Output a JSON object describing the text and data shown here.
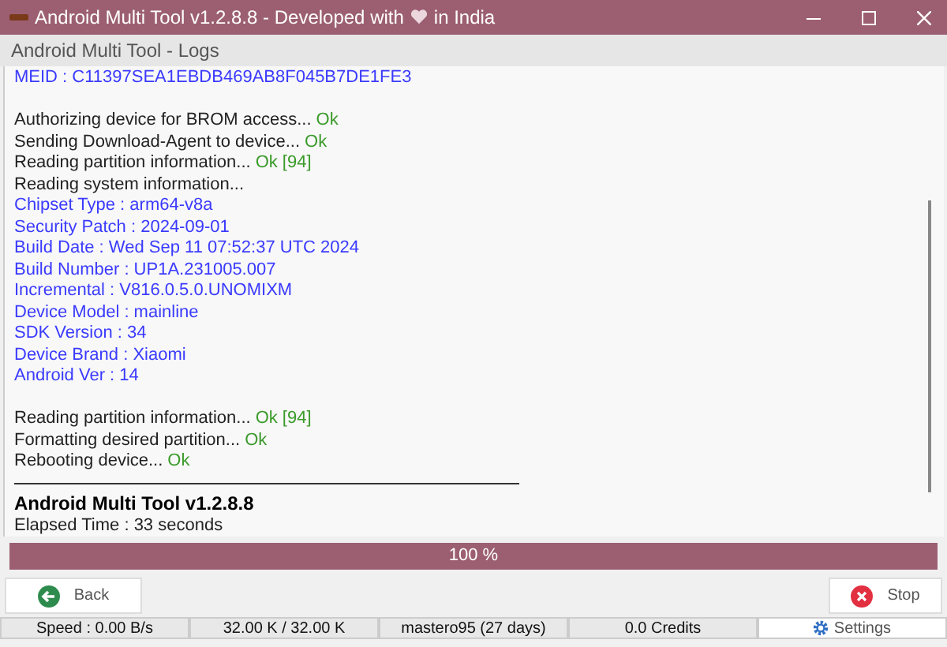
{
  "window": {
    "title": "Android Multi Tool v1.2.8.8 - Developed with",
    "title_suffix": "in India"
  },
  "header": "Android Multi Tool - Logs",
  "log": [
    {
      "kind": "info",
      "text": "MEID : C11397SEA1EBDB469AB8F045B7DE1FE3"
    },
    {
      "kind": "blank"
    },
    {
      "kind": "plain",
      "text": "Authorizing device for BROM access...",
      "status": "Ok"
    },
    {
      "kind": "plain",
      "text": "Sending Download-Agent to device...",
      "status": "Ok"
    },
    {
      "kind": "plain",
      "text": "Reading partition information...",
      "status": "Ok [94]"
    },
    {
      "kind": "plain",
      "text": "Reading system information..."
    },
    {
      "kind": "info",
      "text": "Chipset Type : arm64-v8a"
    },
    {
      "kind": "info",
      "text": "Security Patch : 2024-09-01"
    },
    {
      "kind": "info",
      "text": "Build Date : Wed Sep 11 07:52:37 UTC 2024"
    },
    {
      "kind": "info",
      "text": "Build Number : UP1A.231005.007"
    },
    {
      "kind": "info",
      "text": "Incremental : V816.0.5.0.UNOMIXM"
    },
    {
      "kind": "info",
      "text": "Device Model : mainline"
    },
    {
      "kind": "info",
      "text": "SDK Version : 34"
    },
    {
      "kind": "info",
      "text": "Device Brand : Xiaomi"
    },
    {
      "kind": "info",
      "text": "Android Ver : 14"
    },
    {
      "kind": "blank"
    },
    {
      "kind": "plain",
      "text": "Reading partition information...",
      "status": "Ok [94]"
    },
    {
      "kind": "plain",
      "text": "Formatting desired partition...",
      "status": "Ok"
    },
    {
      "kind": "plain",
      "text": "Rebooting device...",
      "status": "Ok"
    },
    {
      "kind": "rule"
    },
    {
      "kind": "title",
      "text": "Android Multi Tool v1.2.8.8"
    },
    {
      "kind": "plain",
      "text": "Elapsed Time : 33 seconds"
    }
  ],
  "progress": {
    "level": 1,
    "label": "100 %"
  },
  "buttons": {
    "back": "Back",
    "stop": "Stop"
  },
  "status_bar": [
    "Speed : 0.00 B/s",
    "32.00 K / 32.00 K",
    "mastero95 (27 days)",
    "0.0 Credits"
  ],
  "settings": "Settings"
}
